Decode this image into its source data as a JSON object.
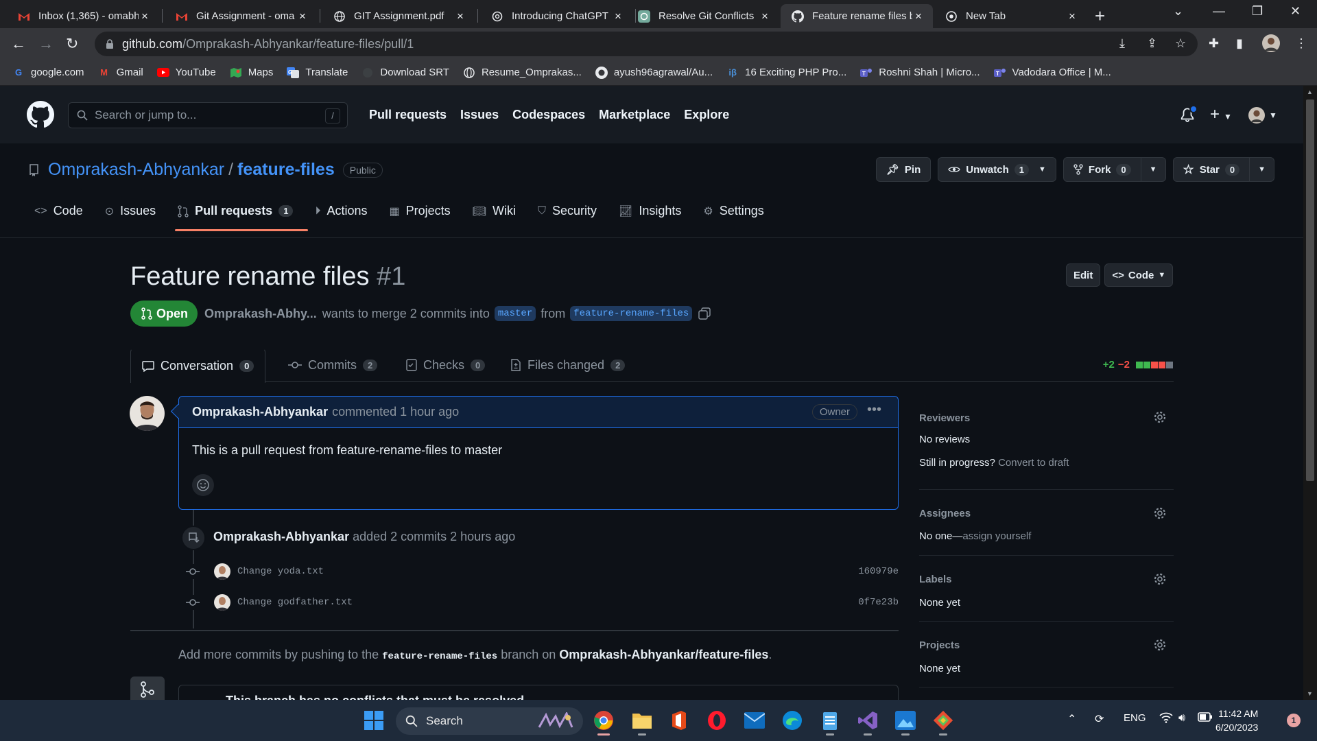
{
  "browser": {
    "tabs": [
      {
        "title": "Inbox (1,365) - omabh",
        "favicon": "gmail-icon"
      },
      {
        "title": "Git Assignment - oma",
        "favicon": "gmail-icon"
      },
      {
        "title": "GIT Assignment.pdf",
        "favicon": "globe-icon"
      },
      {
        "title": "Introducing ChatGPT",
        "favicon": "openai-icon"
      },
      {
        "title": "Resolve Git Conflicts",
        "favicon": "chatgpt-icon"
      },
      {
        "title": "Feature rename files b",
        "favicon": "github-icon"
      },
      {
        "title": "New Tab",
        "favicon": "chrome-icon"
      }
    ],
    "url_host": "github.com",
    "url_path": "/Omprakash-Abhyankar/feature-files/pull/1",
    "bookmarks": [
      {
        "label": "google.com",
        "icon": "google-icon"
      },
      {
        "label": "Gmail",
        "icon": "gmail-icon"
      },
      {
        "label": "YouTube",
        "icon": "youtube-icon"
      },
      {
        "label": "Maps",
        "icon": "maps-icon"
      },
      {
        "label": "Translate",
        "icon": "translate-icon"
      },
      {
        "label": "Download SRT",
        "icon": "globe-icon"
      },
      {
        "label": "Resume_Omprakas...",
        "icon": "globe-icon"
      },
      {
        "label": "ayush96agrawal/Au...",
        "icon": "github-icon"
      },
      {
        "label": "16 Exciting PHP Pro...",
        "icon": "ib-icon"
      },
      {
        "label": "Roshni Shah | Micro...",
        "icon": "teams-icon"
      },
      {
        "label": "Vadodara Office | M...",
        "icon": "teams-icon"
      }
    ]
  },
  "gh": {
    "search_placeholder": "Search or jump to...",
    "search_key": "/",
    "nav": [
      "Pull requests",
      "Issues",
      "Codespaces",
      "Marketplace",
      "Explore"
    ]
  },
  "repo": {
    "owner": "Omprakash-Abhyankar",
    "separator": "/",
    "name": "feature-files",
    "visibility": "Public",
    "pin_label": "Pin",
    "watch_label": "Unwatch",
    "watch_count": "1",
    "fork_label": "Fork",
    "fork_count": "0",
    "star_label": "Star",
    "star_count": "0",
    "tabs": [
      {
        "label": "Code",
        "icon": "code-icon"
      },
      {
        "label": "Issues",
        "icon": "issue-icon"
      },
      {
        "label": "Pull requests",
        "icon": "pull-request-icon",
        "count": "1",
        "active": true
      },
      {
        "label": "Actions",
        "icon": "play-icon"
      },
      {
        "label": "Projects",
        "icon": "table-icon"
      },
      {
        "label": "Wiki",
        "icon": "book-icon"
      },
      {
        "label": "Security",
        "icon": "shield-icon"
      },
      {
        "label": "Insights",
        "icon": "graph-icon"
      },
      {
        "label": "Settings",
        "icon": "gear-icon"
      }
    ]
  },
  "pr": {
    "title": "Feature rename files",
    "number": "#1",
    "edit_label": "Edit",
    "code_label": "Code",
    "state": "Open",
    "author": "Omprakash-Abhy...",
    "merge_text": "wants to merge 2 commits into",
    "base": "master",
    "from_text": "from",
    "head": "feature-rename-files",
    "tabs": [
      {
        "label": "Conversation",
        "count": "0",
        "icon": "comment-icon"
      },
      {
        "label": "Commits",
        "count": "2",
        "icon": "commit-icon"
      },
      {
        "label": "Checks",
        "count": "0",
        "icon": "checklist-icon"
      },
      {
        "label": "Files changed",
        "count": "2",
        "icon": "file-diff-icon"
      }
    ],
    "diff_add": "+2",
    "diff_del": "−2",
    "diff_blocks": {
      "added": 2,
      "removed": 2,
      "neutral": 1
    }
  },
  "timeline": {
    "comment": {
      "author": "Omprakash-Abhyankar",
      "meta": "commented 1 hour ago",
      "badge": "Owner",
      "body": "This is a pull request from feature-rename-files to master"
    },
    "event": {
      "author": "Omprakash-Abhyankar",
      "text": "added 2 commits 2 hours ago"
    },
    "commits": [
      {
        "message": "Change yoda.txt",
        "sha": "160979e"
      },
      {
        "message": "Change godfather.txt",
        "sha": "0f7e23b"
      }
    ],
    "push_hint": {
      "prefix": "Add more commits by pushing to the",
      "branch": "feature-rename-files",
      "middle": "branch on",
      "repo": "Omprakash-Abhyankar/feature-files",
      "suffix": "."
    },
    "merge_text": "This branch has no conflicts that must be resolved"
  },
  "sidebar": {
    "reviewers": {
      "label": "Reviewers",
      "value": "No reviews",
      "draft_prefix": "Still in progress?",
      "draft_link": "Convert to draft"
    },
    "assignees": {
      "label": "Assignees",
      "value": "No one—",
      "link": "assign yourself"
    },
    "labels": {
      "label": "Labels",
      "value": "None yet"
    },
    "projects": {
      "label": "Projects",
      "value": "None yet"
    }
  },
  "taskbar": {
    "search_label": "Search",
    "lang": "ENG",
    "time": "11:42 AM",
    "date": "6/20/2023",
    "notifications": "1"
  }
}
